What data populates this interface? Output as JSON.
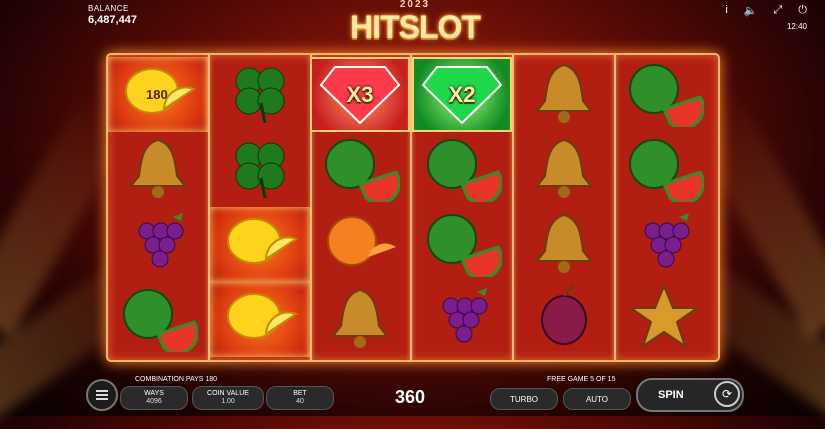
{
  "balance": {
    "label": "BALANCE",
    "value": "6,487,447"
  },
  "logo": {
    "year": "2023",
    "name": "HITSLOT"
  },
  "header": {
    "info": "i",
    "sound": "🔈",
    "fullscreen": "⤢",
    "power": "⏻",
    "time": "12:40"
  },
  "reels": [
    [
      {
        "symbol": "lemon",
        "badge": "180",
        "highlight": true
      },
      {
        "symbol": "bell"
      },
      {
        "symbol": "grapes"
      },
      {
        "symbol": "watermelon"
      }
    ],
    [
      {
        "symbol": "clover"
      },
      {
        "symbol": "clover"
      },
      {
        "symbol": "lemon",
        "highlight": true
      },
      {
        "symbol": "lemon",
        "highlight": true
      }
    ],
    [
      {
        "symbol": "red-diamond",
        "multiplier": "X3"
      },
      {
        "symbol": "watermelon"
      },
      {
        "symbol": "orange"
      },
      {
        "symbol": "bell"
      }
    ],
    [
      {
        "symbol": "green-diamond",
        "multiplier": "X2"
      },
      {
        "symbol": "watermelon"
      },
      {
        "symbol": "watermelon"
      },
      {
        "symbol": "grapes"
      }
    ],
    [
      {
        "symbol": "bell"
      },
      {
        "symbol": "bell"
      },
      {
        "symbol": "bell"
      },
      {
        "symbol": "plum"
      }
    ],
    [
      {
        "symbol": "watermelon"
      },
      {
        "symbol": "watermelon"
      },
      {
        "symbol": "grapes"
      },
      {
        "symbol": "star"
      }
    ]
  ],
  "bottom": {
    "combination": "COMBINATION PAYS 180",
    "free_game": "FREE GAME 5 OF 15",
    "ways_label": "WAYS",
    "ways_value": "4096",
    "coin_label": "COIN VALUE",
    "coin_value": "1.00",
    "bet_label": "BET",
    "bet_value": "40",
    "win": "360",
    "turbo": "TURBO",
    "auto": "AUTO",
    "spin": "SPIN"
  }
}
